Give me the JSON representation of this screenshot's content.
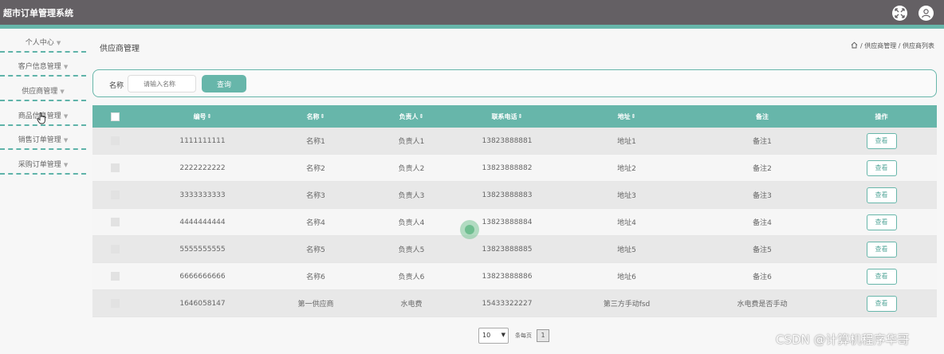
{
  "app": {
    "title": "超市订单管理系统"
  },
  "sidebar": {
    "items": [
      {
        "label": "个人中心"
      },
      {
        "label": "客户信息管理"
      },
      {
        "label": "供应商管理"
      },
      {
        "label": "商品信息管理"
      },
      {
        "label": "销售订单管理"
      },
      {
        "label": "采购订单管理"
      }
    ]
  },
  "page": {
    "title": "供应商管理",
    "breadcrumb": [
      "供应商管理",
      "供应商列表"
    ]
  },
  "search": {
    "label": "名称",
    "placeholder": "请输入名称",
    "button": "查询"
  },
  "table": {
    "columns": [
      "编号",
      "名称",
      "负责人",
      "联系电话",
      "地址",
      "备注",
      "操作"
    ],
    "sortable": [
      true,
      true,
      true,
      true,
      true,
      false,
      false
    ],
    "rows": [
      {
        "id": "1111111111",
        "name": "名称1",
        "contact": "负责人1",
        "phone": "13823888881",
        "address": "地址1",
        "remark": "备注1"
      },
      {
        "id": "2222222222",
        "name": "名称2",
        "contact": "负责人2",
        "phone": "13823888882",
        "address": "地址2",
        "remark": "备注2"
      },
      {
        "id": "3333333333",
        "name": "名称3",
        "contact": "负责人3",
        "phone": "13823888883",
        "address": "地址3",
        "remark": "备注3"
      },
      {
        "id": "4444444444",
        "name": "名称4",
        "contact": "负责人4",
        "phone": "13823888884",
        "address": "地址4",
        "remark": "备注4"
      },
      {
        "id": "5555555555",
        "name": "名称5",
        "contact": "负责人5",
        "phone": "13823888885",
        "address": "地址5",
        "remark": "备注5"
      },
      {
        "id": "6666666666",
        "name": "名称6",
        "contact": "负责人6",
        "phone": "13823888886",
        "address": "地址6",
        "remark": "备注6"
      },
      {
        "id": "1646058147",
        "name": "第一供应商",
        "contact": "水电费",
        "phone": "15433322227",
        "address": "第三方手动fsd",
        "remark": "水电费是否手动"
      }
    ],
    "action_label": "查看"
  },
  "pagination": {
    "page_size": "10",
    "per_page_label": "条每页",
    "current_page": "1"
  },
  "watermark": "CSDN @计算机程序华哥",
  "colors": {
    "accent": "#67b6aa",
    "topbar": "#646064"
  }
}
